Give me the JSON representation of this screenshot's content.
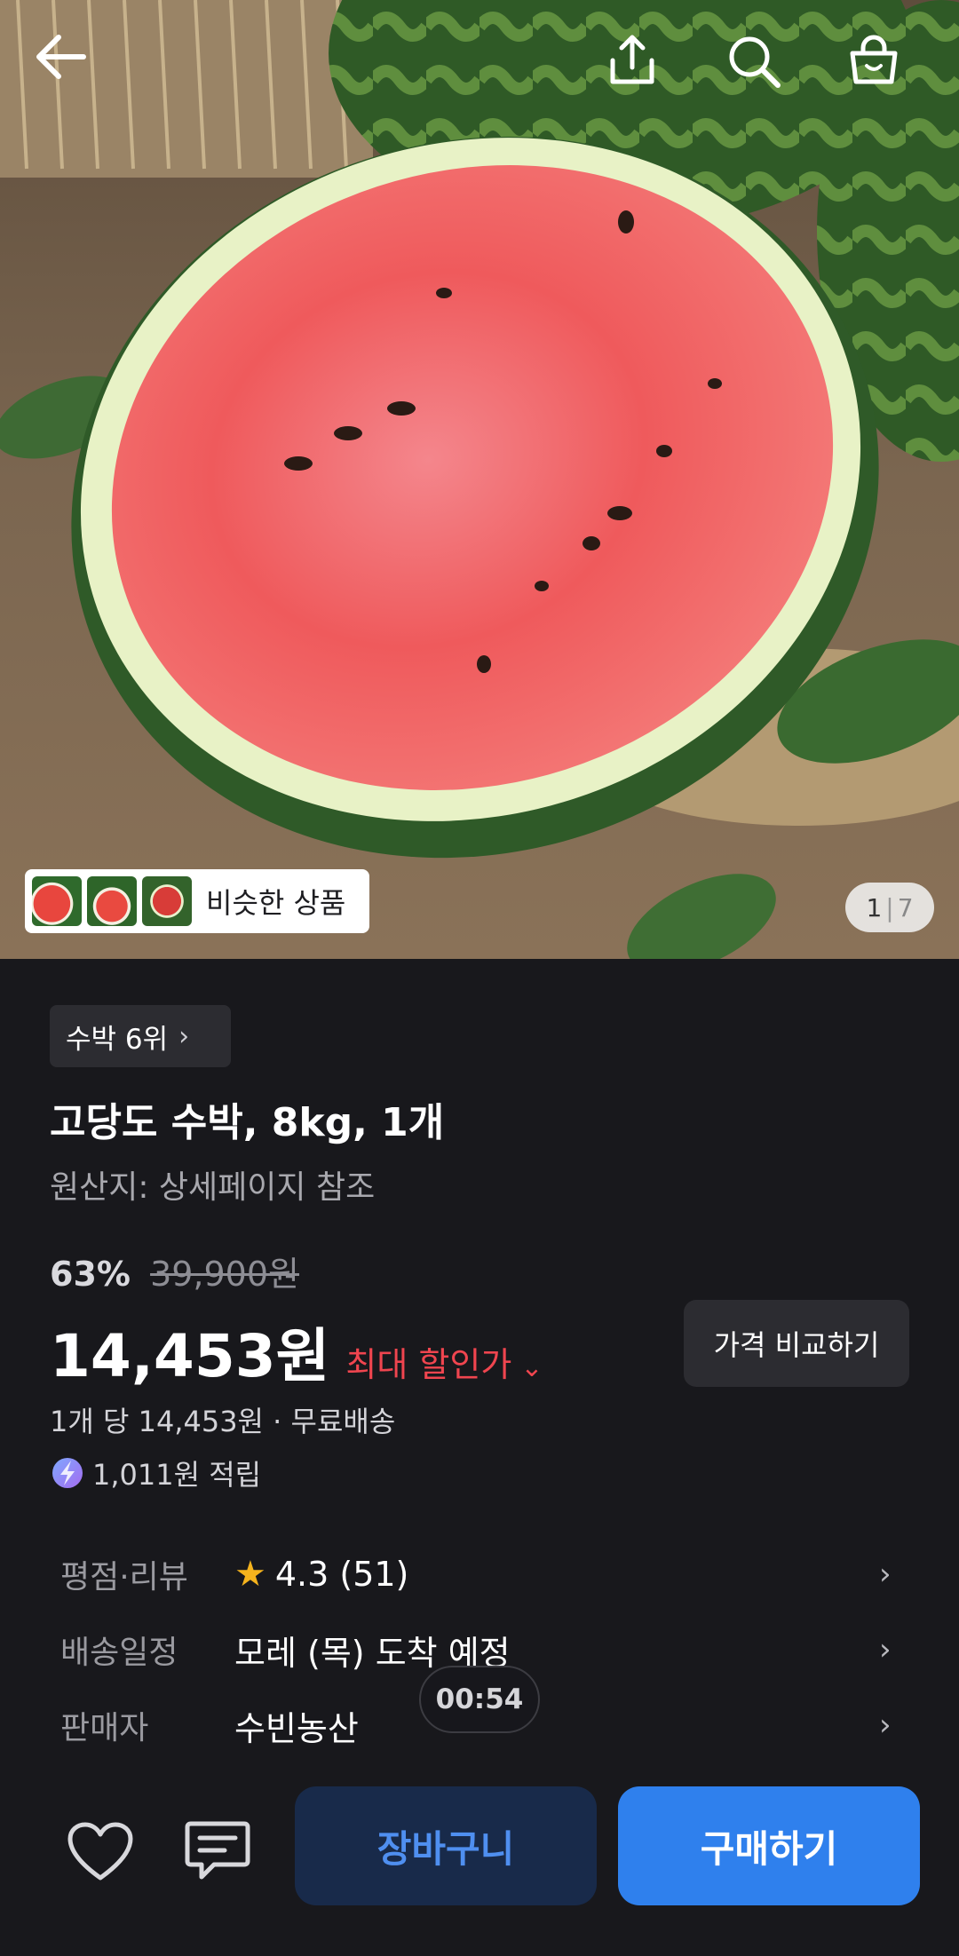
{
  "header": {
    "back_icon": "arrow-left-icon",
    "share_icon": "share-upload-icon",
    "search_icon": "search-icon",
    "cart_icon": "shopping-bag-icon"
  },
  "gallery": {
    "similar_label": "비슷한 상품",
    "current_page": "1",
    "separator": "|",
    "total_pages": "7"
  },
  "product": {
    "rank_label": "수박 6위",
    "title": "고당도 수박, 8kg, 1개",
    "origin": "원산지: 상세페이지 참조",
    "discount_percent": "63%",
    "original_price": "39,900원",
    "price": "14,453원",
    "max_discount_label": "최대 할인가",
    "compare_label": "가격 비교하기",
    "unit_price": "1개 당 14,453원 · 무료배송",
    "points": "1,011원 적립"
  },
  "info": {
    "rating_label": "평점·리뷰",
    "rating_value": "4.3 (51)",
    "delivery_label": "배송일정",
    "delivery_value": "모레 (목) 도착 예정",
    "seller_label": "판매자",
    "seller_value": "수빈농산"
  },
  "timer": "00:54",
  "actions": {
    "wishlist_icon": "heart-icon",
    "chat_icon": "chat-icon",
    "cart_label": "장바구니",
    "buy_label": "구매하기"
  },
  "colors": {
    "accent_blue": "#2f80ed",
    "cart_bg": "#182a4a",
    "discount_red": "#f0454f",
    "star": "#f5b31d",
    "background": "#18181c"
  }
}
